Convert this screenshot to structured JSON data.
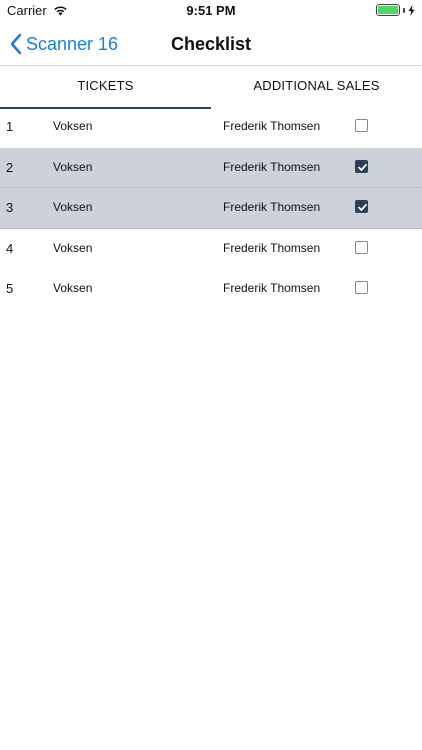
{
  "status_bar": {
    "carrier": "Carrier",
    "time": "9:51 PM"
  },
  "nav": {
    "back_label": "Scanner 16",
    "title": "Checklist"
  },
  "tabs": [
    {
      "label": "TICKETS",
      "active": true
    },
    {
      "label": "ADDITIONAL SALES",
      "active": false
    }
  ],
  "rows": [
    {
      "number": "1",
      "type": "Voksen",
      "name": "Frederik Thomsen",
      "checked": false
    },
    {
      "number": "2",
      "type": "Voksen",
      "name": "Frederik Thomsen",
      "checked": true
    },
    {
      "number": "3",
      "type": "Voksen",
      "name": "Frederik Thomsen",
      "checked": true
    },
    {
      "number": "4",
      "type": "Voksen",
      "name": "Frederik Thomsen",
      "checked": false
    },
    {
      "number": "5",
      "type": "Voksen",
      "name": "Frederik Thomsen",
      "checked": false
    }
  ],
  "colors": {
    "accent": "#1a7fe0",
    "selected_row": "#cdd2da",
    "checkbox_on": "#2d3e5a",
    "battery": "#4cd964"
  }
}
